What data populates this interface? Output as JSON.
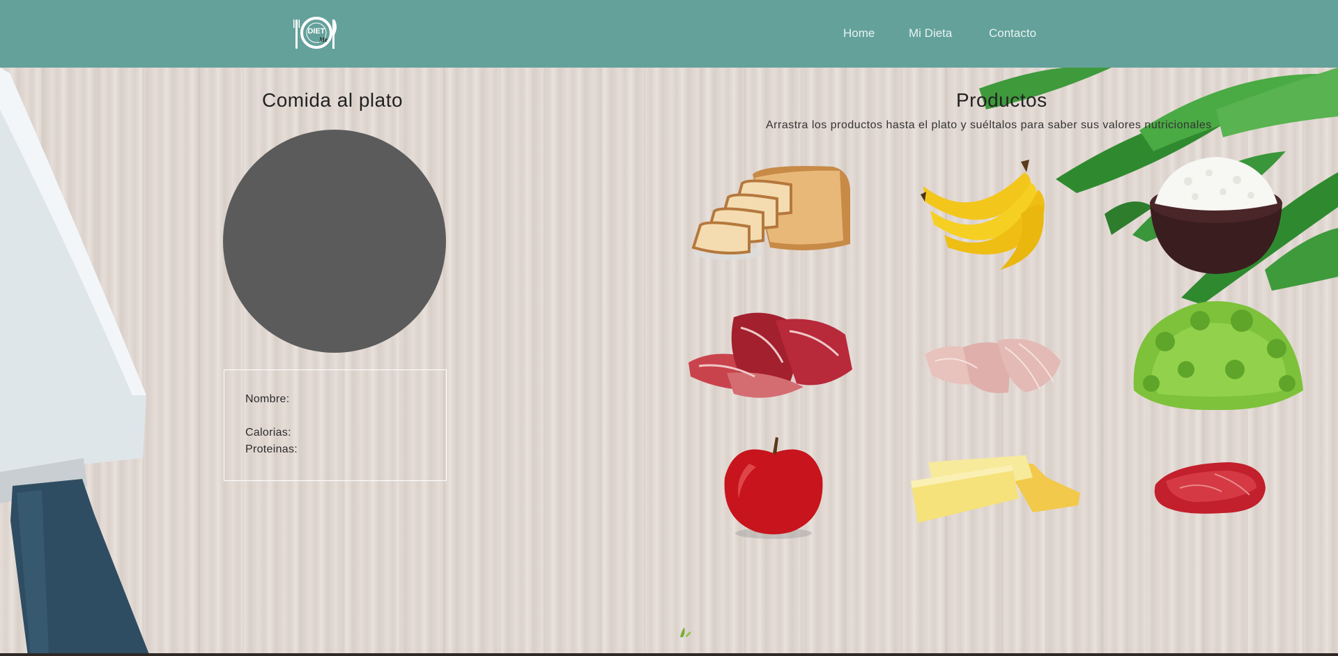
{
  "header": {
    "logo_text_top": "DIET",
    "logo_text_bottom": "Me",
    "nav": [
      {
        "label": "Home"
      },
      {
        "label": "Mi Dieta"
      },
      {
        "label": "Contacto"
      }
    ]
  },
  "plate_section": {
    "title": "Comida al plato",
    "info": {
      "nombre_label": "Nombre:",
      "calorias_label": "Calorias:",
      "proteinas_label": "Proteinas:"
    }
  },
  "products_section": {
    "title": "Productos",
    "subtitle": "Arrastra los productos hasta el plato y suéltalos para saber sus valores nutricionales",
    "items": [
      {
        "icon": "bread-icon"
      },
      {
        "icon": "banana-icon"
      },
      {
        "icon": "rice-bowl-icon"
      },
      {
        "icon": "cured-ham-icon"
      },
      {
        "icon": "turkey-slices-icon"
      },
      {
        "icon": "lettuce-icon"
      },
      {
        "icon": "apple-icon"
      },
      {
        "icon": "cheese-icon"
      },
      {
        "icon": "steak-icon"
      }
    ]
  },
  "colors": {
    "header_bg": "#64a19b",
    "plate": "#5b5b5b",
    "wood": "#e3dad4"
  }
}
